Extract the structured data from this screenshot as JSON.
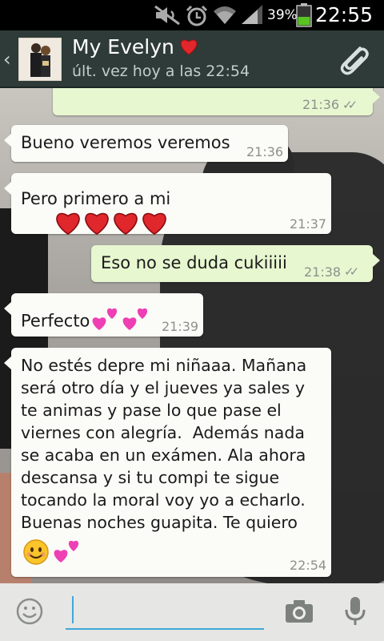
{
  "status_bar": {
    "battery_percent": "39%",
    "time": "22:55",
    "icons": [
      "mute-icon",
      "alarm-icon",
      "wifi-icon",
      "signal-icon",
      "battery-icon"
    ]
  },
  "header": {
    "contact_name": "My Evelyn",
    "last_seen": "últ. vez hoy a las 22:54",
    "icons": [
      "back-chevron-icon",
      "avatar",
      "red-heart-icon",
      "attach-icon"
    ]
  },
  "messages": [
    {
      "direction": "outgoing",
      "text": "",
      "time": "21:36",
      "ticks": "✓✓"
    },
    {
      "direction": "incoming",
      "text": "Bueno veremos veremos",
      "time": "21:36"
    },
    {
      "direction": "incoming",
      "text": "Pero primero a mi",
      "time": "21:37",
      "emoji": [
        "red-heart",
        "red-heart",
        "red-heart",
        "red-heart"
      ]
    },
    {
      "direction": "outgoing",
      "text": "Eso no se duda cukiiiii",
      "time": "21:38",
      "ticks": "✓✓"
    },
    {
      "direction": "incoming",
      "text": "Perfecto",
      "time": "21:39",
      "emoji": [
        "two-pink-hearts",
        "two-pink-hearts"
      ]
    },
    {
      "direction": "incoming",
      "text": "No estés depre mi niñaaa. Mañana\nserá otro día y el jueves ya sales y\nte animas y pase lo que pase el\nviernes con alegría.  Además nada\nse acaba en un exámen. Ala ahora\ndescansa y si tu compi te sigue\ntocando la moral voy yo a echarlo.\nBuenas noches guapita. Te quiero",
      "time": "22:54",
      "emoji": [
        "smiling-face",
        "two-pink-hearts"
      ]
    }
  ],
  "input_bar": {
    "icons": [
      "emoji-icon",
      "camera-icon",
      "microphone-icon"
    ],
    "text_value": ""
  },
  "colors": {
    "header_bg": "#2e3b38",
    "incoming_bubble": "#fbfbf7",
    "outgoing_bubble": "#e7f7d0",
    "input_accent": "#3fa8d8"
  }
}
